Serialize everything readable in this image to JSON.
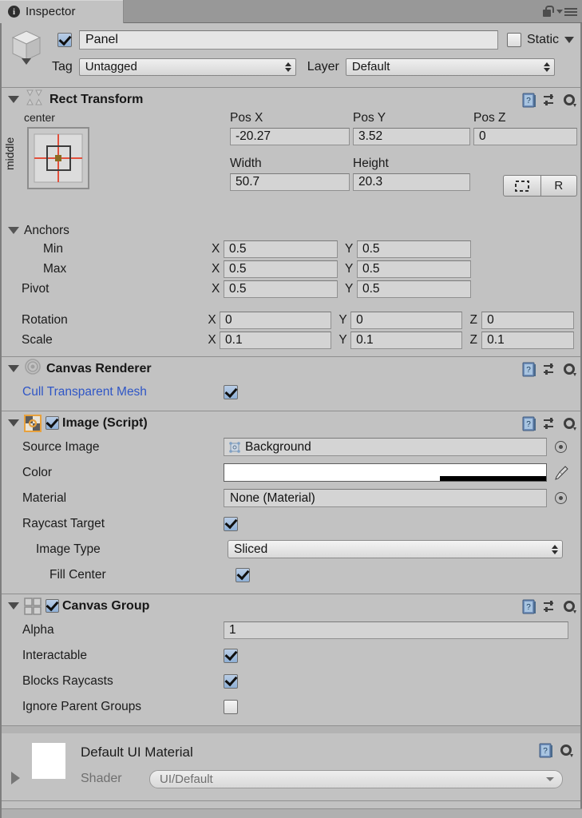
{
  "window": {
    "tab_title": "Inspector",
    "info_icon": "info-icon",
    "lock_icon": "lock-icon",
    "menu_icon": "hamburger-menu-icon"
  },
  "object_header": {
    "enabled": true,
    "name": "Panel",
    "static_label": "Static",
    "static_checked": false,
    "tag_label": "Tag",
    "tag_value": "Untagged",
    "layer_label": "Layer",
    "layer_value": "Default",
    "prefab_icon": "cube-icon"
  },
  "components": [
    {
      "id": "rect-transform",
      "title": "Rect Transform",
      "icon": "rect-transform-icon",
      "expanded": true,
      "has_enable_toggle": false,
      "anchor_preset": {
        "top_label": "center",
        "left_label": "middle"
      },
      "fields": {
        "pos_x_label": "Pos X",
        "pos_x": "-20.27",
        "pos_y_label": "Pos Y",
        "pos_y": "3.52",
        "pos_z_label": "Pos Z",
        "pos_z": "0",
        "width_label": "Width",
        "width": "50.7",
        "height_label": "Height",
        "height": "20.3",
        "blueprint_label": "",
        "raw_label": "R"
      },
      "anchors": {
        "title": "Anchors",
        "min_label": "Min",
        "min_x": "0.5",
        "min_y": "0.5",
        "max_label": "Max",
        "max_x": "0.5",
        "max_y": "0.5"
      },
      "pivot": {
        "label": "Pivot",
        "x": "0.5",
        "y": "0.5"
      },
      "rotation": {
        "label": "Rotation",
        "x": "0",
        "y": "0",
        "z": "0"
      },
      "scale": {
        "label": "Scale",
        "x": "0.1",
        "y": "0.1",
        "z": "0.1"
      },
      "axis_x": "X",
      "axis_y": "Y",
      "axis_z": "Z"
    },
    {
      "id": "canvas-renderer",
      "title": "Canvas Renderer",
      "icon": "canvas-renderer-icon",
      "expanded": true,
      "rows": [
        {
          "label": "Cull Transparent Mesh",
          "type": "checkbox",
          "value": true,
          "label_color": "#2f56c6"
        }
      ]
    },
    {
      "id": "image-script",
      "title": "Image (Script)",
      "icon": "image-component-icon",
      "expanded": true,
      "enabled": true,
      "rows": [
        {
          "label": "Source Image",
          "type": "object",
          "value": "Background",
          "icon": "sprite-icon"
        },
        {
          "label": "Color",
          "type": "color",
          "value": "#FFFFFF",
          "alpha_bar": "#000000"
        },
        {
          "label": "Material",
          "type": "object",
          "value": "None (Material)"
        },
        {
          "label": "Raycast Target",
          "type": "checkbox",
          "value": true
        },
        {
          "label": "Image Type",
          "type": "dropdown",
          "value": "Sliced"
        },
        {
          "label": "Fill Center",
          "type": "checkbox",
          "value": true
        }
      ]
    },
    {
      "id": "canvas-group",
      "title": "Canvas Group",
      "icon": "canvas-group-icon",
      "expanded": true,
      "enabled": true,
      "rows": [
        {
          "label": "Alpha",
          "type": "number",
          "value": "1"
        },
        {
          "label": "Interactable",
          "type": "checkbox",
          "value": true
        },
        {
          "label": "Blocks Raycasts",
          "type": "checkbox",
          "value": true
        },
        {
          "label": "Ignore Parent Groups",
          "type": "checkbox",
          "value": false
        }
      ]
    }
  ],
  "material_footer": {
    "title": "Default UI Material",
    "shader_label": "Shader",
    "shader_value": "UI/Default",
    "expanded": false
  },
  "colors": {
    "panel_bg": "#c2c2c2",
    "window_bg": "#a3a3a3",
    "field_bg": "#d4d4d4",
    "link_blue": "#2f56c6",
    "accent_orange": "#e8a13c",
    "text": "#1b1b1b"
  }
}
